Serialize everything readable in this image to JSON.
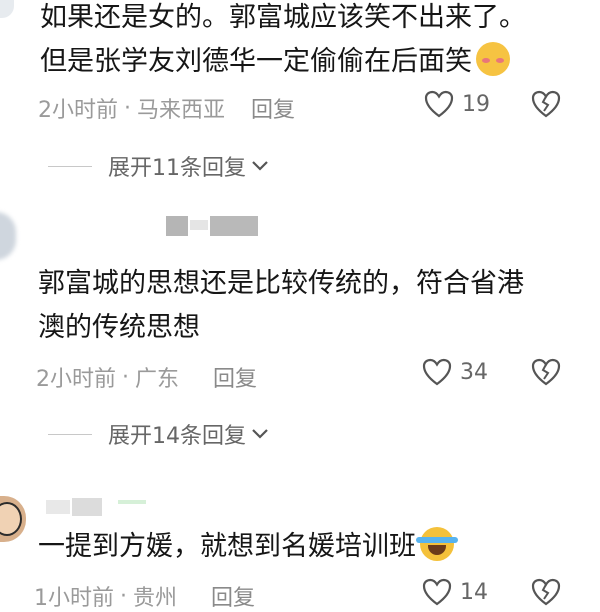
{
  "comments": [
    {
      "lines": [
        "如果还是女的。郭富城应该笑不出来了。",
        "但是张学友刘德华一定偷偷在后面笑"
      ],
      "emoji": "shy-face-emoji",
      "time": "2小时前",
      "location": "马来西亚",
      "reply_label": "回复",
      "likes": "19",
      "expand_label": "展开11条回复"
    },
    {
      "lines": [
        "郭富城的思想还是比较传统的，符合省港",
        "澳的传统思想"
      ],
      "time": "2小时前",
      "location": "广东",
      "reply_label": "回复",
      "likes": "34",
      "expand_label": "展开14条回复"
    },
    {
      "lines": [
        "一提到方媛，就想到名媛培训班"
      ],
      "emoji": "loudly-crying-emoji",
      "time": "1小时前",
      "location": "贵州",
      "reply_label": "回复",
      "likes": "14"
    }
  ],
  "separator": "·",
  "icons": {
    "like": "heart-icon",
    "dislike": "broken-heart-icon",
    "expand": "chevron-down-icon"
  },
  "colors": {
    "text": "#161616",
    "meta": "#9a9a9a",
    "icon": "#555555"
  }
}
